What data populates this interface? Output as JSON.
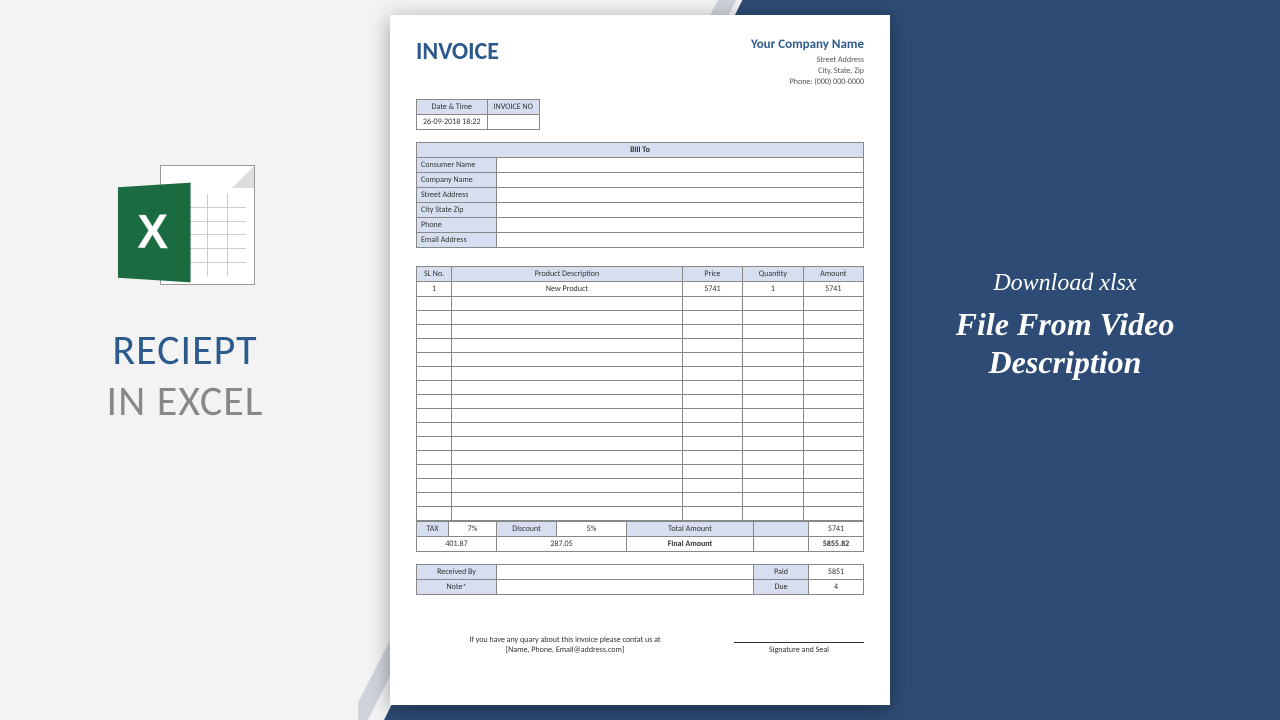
{
  "left": {
    "title1": "RECIEPT",
    "title2": "IN EXCEL",
    "icon_letter": "X"
  },
  "right": {
    "subtitle": "Download xlsx",
    "main": "File From Video Description"
  },
  "invoice": {
    "title": "INVOICE",
    "company": {
      "name": "Your Company Name",
      "street": "Street Address",
      "city": "City, State, Zip",
      "phone": "Phone: (000) 000-0000"
    },
    "date_label": "Date & Time",
    "invoice_no_label": "INVOICE NO",
    "date_value": "26-09-2018 18:22",
    "billto": {
      "header": "Bill To",
      "rows": [
        "Consumer Name",
        "Company Name",
        "Street Address",
        "City State Zip",
        "Phone",
        "Email Address"
      ]
    },
    "items_header": {
      "sl": "SL No.",
      "desc": "Product Description",
      "price": "Price",
      "qty": "Quantity",
      "amt": "Amount"
    },
    "items": [
      {
        "sl": "1",
        "desc": "New Product",
        "price": "5741",
        "qty": "1",
        "amt": "5741"
      }
    ],
    "totals": {
      "tax_label": "TAX",
      "tax_pct": "7%",
      "disc_label": "Discount",
      "disc_pct": "5%",
      "total_label": "Total Amount",
      "total_val": "5741",
      "tax_val": "401.87",
      "disc_val": "287.05",
      "final_label": "Final Amount",
      "final_val": "5855.82"
    },
    "receive": {
      "rcv_label": "Received By",
      "paid_label": "Paid",
      "paid_val": "5851",
      "note_label": "Note*",
      "due_label": "Due",
      "due_val": "4"
    },
    "footer": {
      "line1": "If you have any quary about this invoice please contat us at",
      "line2": "[Name, Phone, Email@address.com]",
      "sig": "Signature and Seal"
    }
  }
}
